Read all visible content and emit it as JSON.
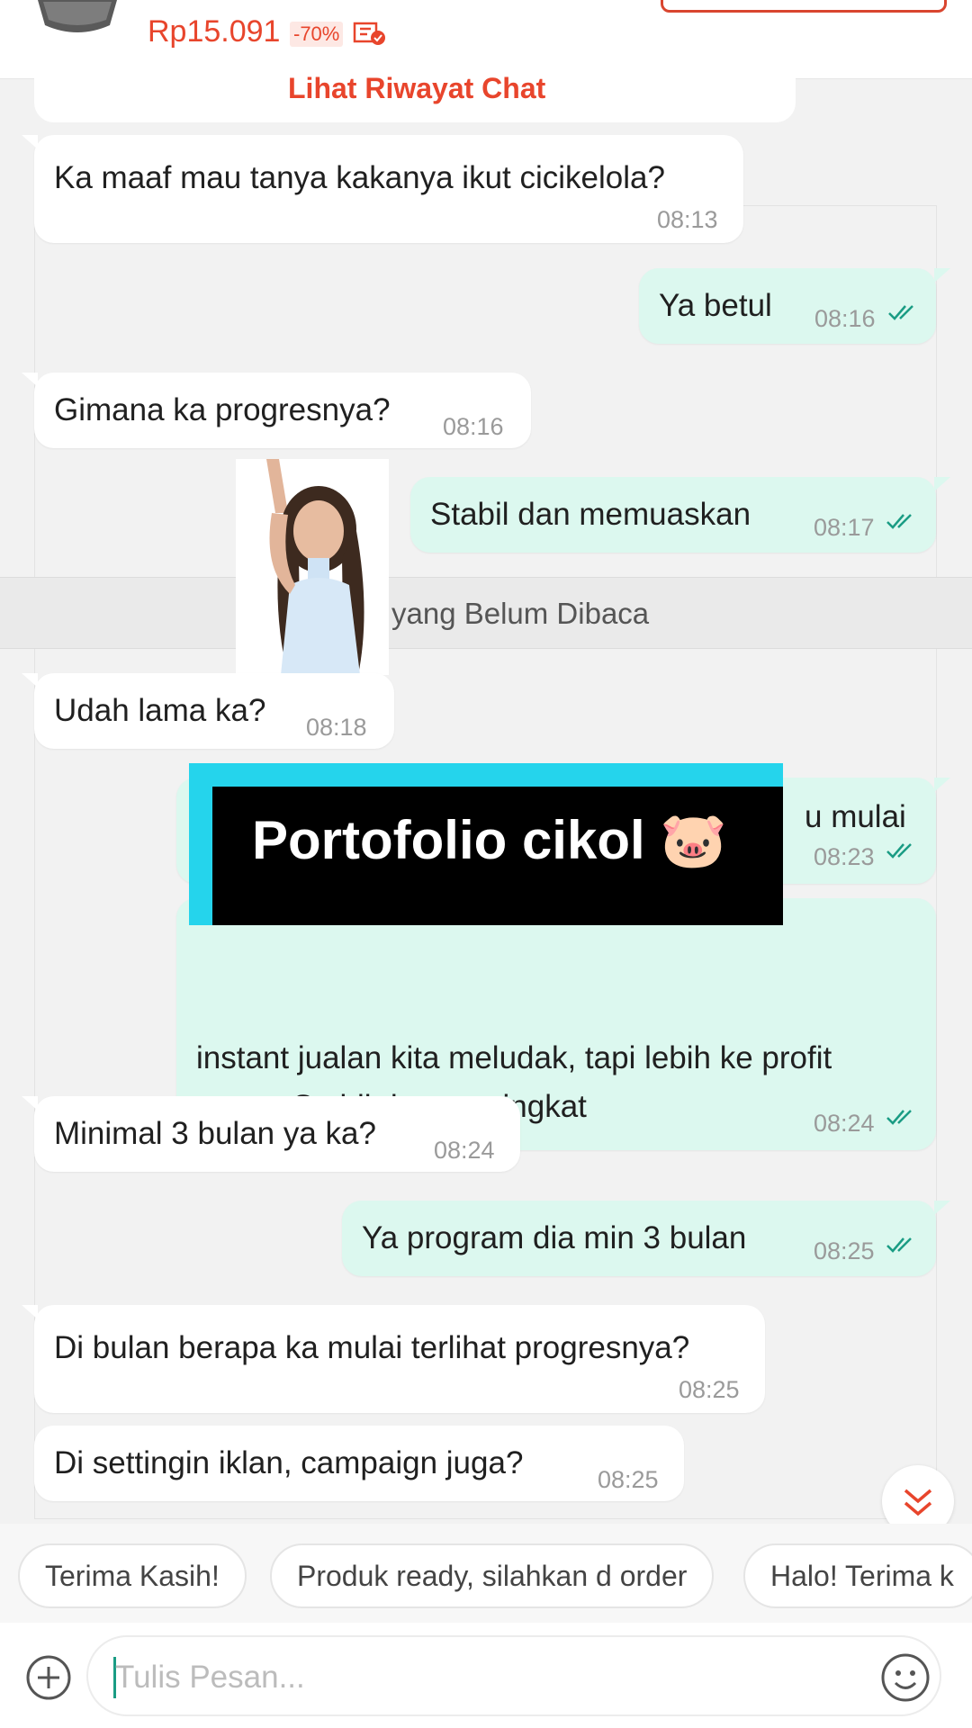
{
  "product": {
    "price": "Rp15.091",
    "discount": "-70%"
  },
  "history_link": "Lihat Riwayat Chat",
  "unread_label": "yang Belum Dibaca",
  "messages": [
    {
      "side": "in",
      "text": "Ka maaf mau tanya kakanya ikut cicikelola?",
      "time": "08:13"
    },
    {
      "side": "out",
      "text": "Ya betul",
      "time": "08:16"
    },
    {
      "side": "in",
      "text": "Gimana ka progresnya?",
      "time": "08:16"
    },
    {
      "side": "out",
      "text": "Stabil dan memuaskan",
      "time": "08:17"
    },
    {
      "side": "in",
      "text": "Udah lama ka?",
      "time": "08:18"
    },
    {
      "side": "out",
      "text": "u mulai",
      "time": "08:23"
    },
    {
      "side": "out",
      "text_line1": "instant jualan kita meludak, tapi lebih ke profit",
      "text_line2": "aman. Stabil dan meningkat",
      "time": "08:24"
    },
    {
      "side": "in",
      "text": "Minimal 3 bulan ya ka?",
      "time": "08:24"
    },
    {
      "side": "out",
      "text": "Ya program dia min 3 bulan",
      "time": "08:25"
    },
    {
      "side": "in",
      "text": "Di bulan berapa ka mulai terlihat progresnya?",
      "time": "08:25"
    },
    {
      "side": "in",
      "text": "Di settingin iklan, campaign juga?",
      "time": "08:25"
    }
  ],
  "overlay_caption": "Portofolio cikol 🐷",
  "quick_replies": [
    "Terima Kasih!",
    "Produk ready, silahkan d order",
    "Halo! Terima k"
  ],
  "input": {
    "placeholder": "Tulis Pesan..."
  },
  "colors": {
    "accent": "#e8452c",
    "outgoing_bubble": "#dcf8ef",
    "tick": "#1a9c84"
  }
}
